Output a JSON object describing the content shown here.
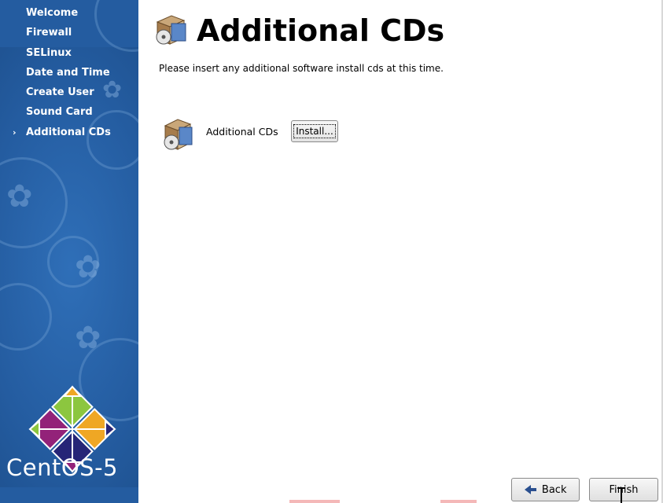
{
  "sidebar": {
    "steps": [
      {
        "label": "Welcome",
        "current": false
      },
      {
        "label": "Firewall",
        "current": false
      },
      {
        "label": "SELinux",
        "current": false
      },
      {
        "label": "Date and Time",
        "current": false
      },
      {
        "label": "Create User",
        "current": false
      },
      {
        "label": "Sound Card",
        "current": false
      },
      {
        "label": "Additional CDs",
        "current": true
      }
    ],
    "current_marker": "›",
    "brand": "CentOS-5"
  },
  "main": {
    "title": "Additional CDs",
    "description": "Please insert any additional software install cds at this time.",
    "cd_item": {
      "label": "Additional CDs",
      "button": "Install..."
    }
  },
  "footer": {
    "back": "Back",
    "finish": "Finish"
  },
  "colors": {
    "sidebar_bg": "#245ca0",
    "logo_green": "#8cc63f",
    "logo_purple": "#932279",
    "logo_orange": "#efa724",
    "logo_blue": "#262577"
  }
}
